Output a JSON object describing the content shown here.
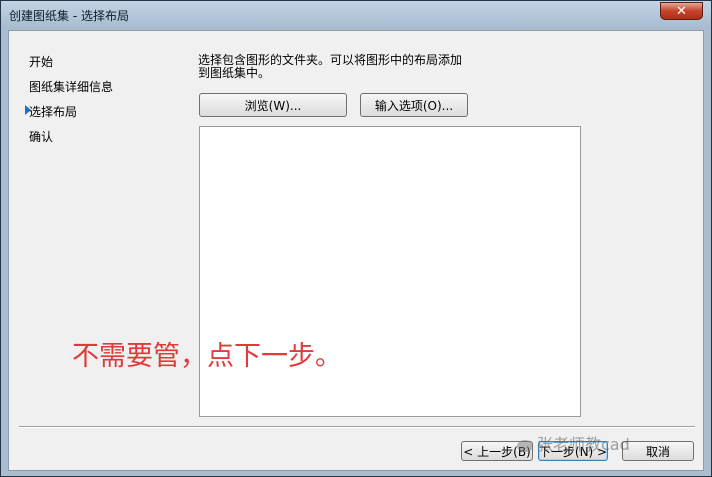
{
  "window": {
    "title": "创建图纸集 - 选择布局",
    "close_glyph": "✕"
  },
  "steps": [
    {
      "label": "开始"
    },
    {
      "label": "图纸集详细信息"
    },
    {
      "label": "选择布局",
      "current": true
    },
    {
      "label": "确认"
    }
  ],
  "main": {
    "instruction_line1": "选择包含图形的文件夹。可以将图形中的布局添加",
    "instruction_line2": "到图纸集中。",
    "browse_label": "浏览(W)...",
    "import_options_label": "输入选项(O)..."
  },
  "annotation": "不需要管，点下一步。",
  "footer": {
    "back_label": "< 上一步(B)",
    "next_label": "下一步(N) >",
    "cancel_label": "取消"
  },
  "watermark": "张老师教cad",
  "colors": {
    "annotation": "#e03a3a",
    "current_step_arrow": "#1f6fc5",
    "close_button": "#c3442b"
  }
}
